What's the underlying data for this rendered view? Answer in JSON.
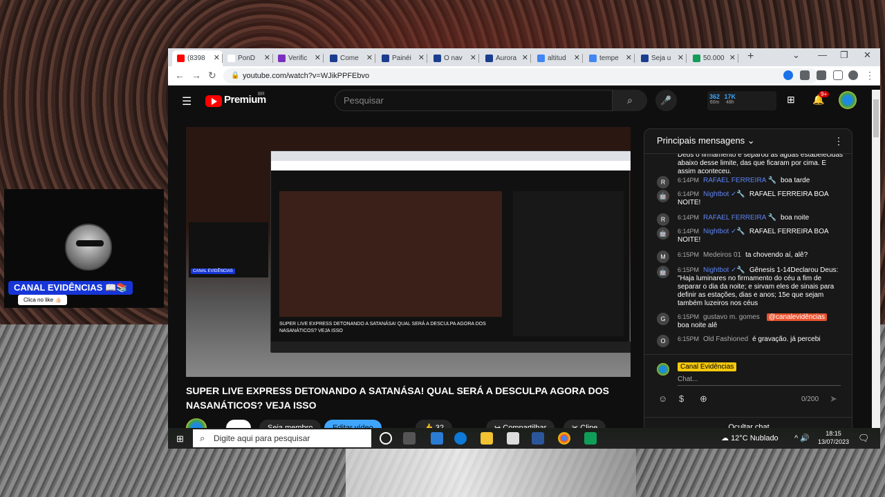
{
  "browser": {
    "tabs": [
      {
        "label": "(8398",
        "color": "#ff0000",
        "active": true
      },
      {
        "label": "PonD",
        "color": "#ffffff"
      },
      {
        "label": "Verific",
        "color": "#7b2fbe"
      },
      {
        "label": "Come",
        "color": "#1a3d8f"
      },
      {
        "label": "Painéi",
        "color": "#1a3d8f"
      },
      {
        "label": "O nav",
        "color": "#1a3d8f"
      },
      {
        "label": "Aurora",
        "color": "#1a3d8f"
      },
      {
        "label": "altitud",
        "color": "#4285f4"
      },
      {
        "label": "tempe",
        "color": "#4285f4"
      },
      {
        "label": "Seja u",
        "color": "#1a3d8f"
      },
      {
        "label": "50.000",
        "color": "#0f9d58"
      }
    ],
    "url": "youtube.com/watch?v=WJikPPFEbvo"
  },
  "youtube": {
    "logo_text": "Premium",
    "region": "BR",
    "search_placeholder": "Pesquisar",
    "stats": {
      "a": "362",
      "a_sub": "60m",
      "b": "17K",
      "b_sub": "48h"
    },
    "notifications": "9+"
  },
  "webcam": {
    "channel_label": "CANAL EVIDÊNCIAS 📖📚",
    "click_label": "Clica no like 👍🏻"
  },
  "video": {
    "title": "SUPER LIVE EXPRESS DETONANDO A SATANÁSA! QUAL SERÁ A DESCULPA AGORA DOS NASANÁTICOS? VEJA ISSO",
    "inner_title": "SUPER LIVE EXPRESS DETONANDO A SATANÁSA! QUAL SERÁ A DESCULPA AGORA DOS NASANÁTICOS? VEJA ISSO",
    "inner_channel": "CANAL EVIDÊNCIAS",
    "join": "Seja membro",
    "edit": "Editar vídeo",
    "likes": "32",
    "share": "Compartilhar",
    "clip": "Clipe"
  },
  "chat": {
    "header": "Principais mensagens",
    "messages": [
      {
        "avatar": "",
        "time": "",
        "author": "",
        "text": "Deus o firmamento e separou as águas estabelecidas abaixo desse limite, das que ficaram por cima. E assim aconteceu."
      },
      {
        "avatar": "R",
        "time": "6:14PM",
        "author": "RAFAEL FERREIRA 🔧",
        "text": "boa tarde"
      },
      {
        "avatar": "🤖",
        "time": "6:14PM",
        "author": "Nightbot ✓🔧",
        "text": "RAFAEL FERREIRA BOA NOITE!"
      },
      {
        "avatar": "R",
        "time": "6:14PM",
        "author": "RAFAEL FERREIRA 🔧",
        "text": "boa noite"
      },
      {
        "avatar": "🤖",
        "time": "6:14PM",
        "author": "Nightbot ✓🔧",
        "text": "RAFAEL FERREIRA BOA NOITE!"
      },
      {
        "avatar": "M",
        "time": "6:15PM",
        "author": "Medeiros 01",
        "text": "ta chovendo aí, alê?"
      },
      {
        "avatar": "🤖",
        "time": "6:15PM",
        "author": "Nightbot ✓🔧",
        "text": "Gênesis 1-14Declarou Deus: \"Haja luminares no firmamento do céu a fim de separar o dia da noite; e sirvam eles de sinais para definir as estações, dias e anos; 15e que sejam também luzeiros nos céus"
      },
      {
        "avatar": "G",
        "time": "6:15PM",
        "author": "gustavo m. gomes",
        "tag": "@canalevidências",
        "text": "boa noite alê"
      },
      {
        "avatar": "O",
        "time": "6:15PM",
        "author": "Old Fashioned",
        "text": "é gravação. já percebi"
      }
    ],
    "me": "Canal Evidências",
    "placeholder": "Chat...",
    "counter": "0/200",
    "hide": "Ocultar chat"
  },
  "taskbar": {
    "search": "Digite aqui para pesquisar",
    "weather": "12°C  Nublado",
    "time": "18:15",
    "date": "13/07/2023"
  }
}
